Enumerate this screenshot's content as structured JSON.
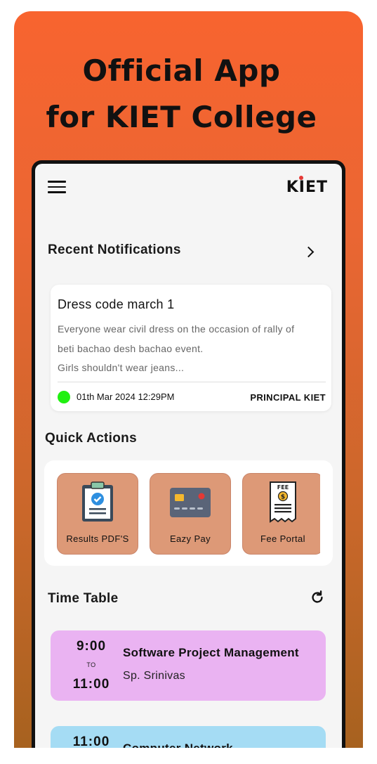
{
  "promo": {
    "headline_line1": "Official App",
    "headline_line2": "for KIET College"
  },
  "app": {
    "logo": "KIET",
    "notifications": {
      "section_title": "Recent Notifications",
      "items": [
        {
          "title": "Dress code march 1",
          "body_line1": "Everyone wear civil dress on the occasion of rally of",
          "body_line2": "beti bachao desh bachao event.",
          "body_line3": "Girls shouldn't wear jeans...",
          "date": "01th Mar 2024 12:29PM",
          "author": "PRINCIPAL KIET",
          "status_color": "#20f010"
        }
      ]
    },
    "quick_actions": {
      "section_title": "Quick Actions",
      "items": [
        {
          "label": "Results PDF'S",
          "icon": "clipboard-check-icon"
        },
        {
          "label": "Eazy Pay",
          "icon": "credit-card-icon"
        },
        {
          "label": "Fee Portal",
          "icon": "fee-receipt-icon"
        }
      ],
      "fee_icon_text": "FEE"
    },
    "timetable": {
      "section_title": "Time Table",
      "entries": [
        {
          "start": "9:00",
          "to": "TO",
          "end": "11:00",
          "subject": "Software Project Management",
          "faculty": "Sp. Srinivas",
          "color": "#eab3f2"
        },
        {
          "start": "11:00",
          "to": "",
          "end": "",
          "subject": "Computer Network",
          "faculty": "",
          "color": "#a5dcf4"
        }
      ]
    }
  },
  "colors": {
    "accent": "#f8642f",
    "tile": "#dd9977"
  }
}
